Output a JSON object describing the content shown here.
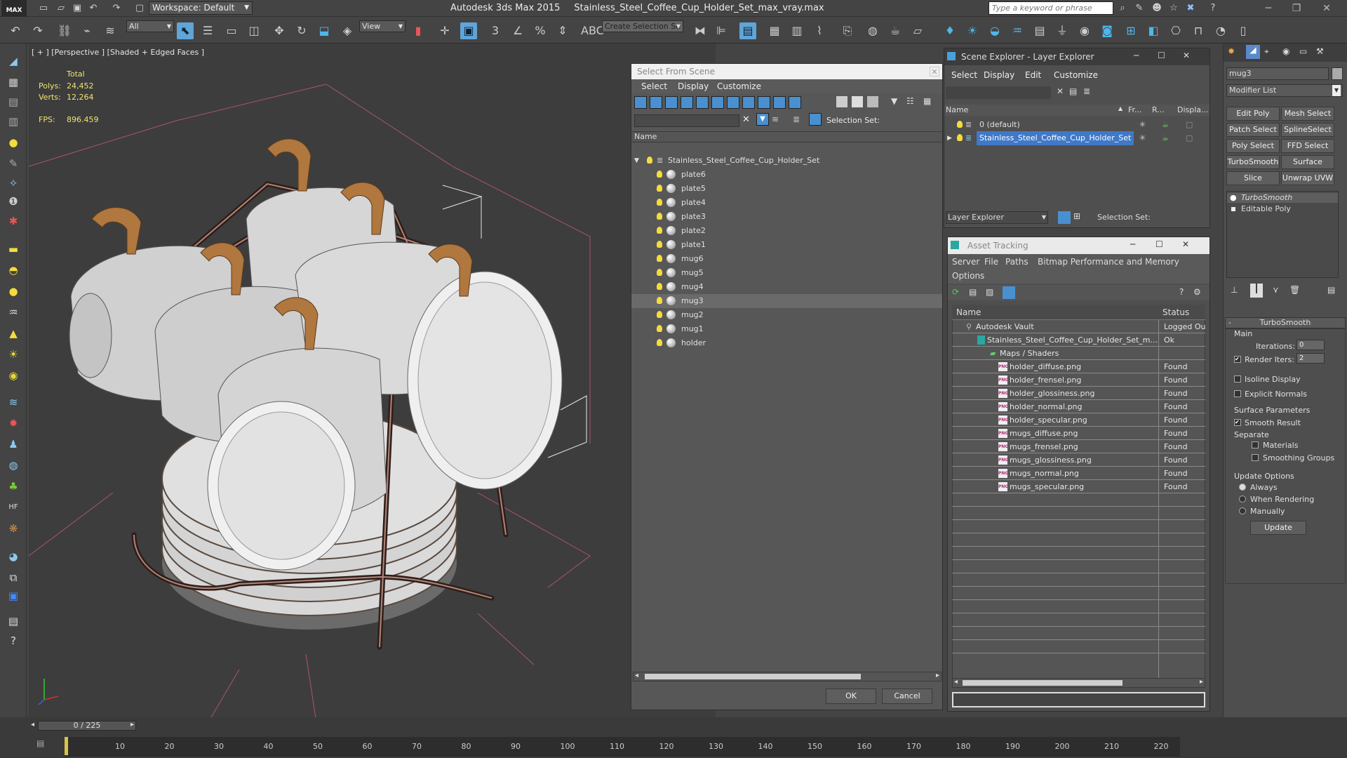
{
  "app": {
    "title": "Autodesk 3ds Max  2015",
    "file": "Stainless_Steel_Coffee_Cup_Holder_Set_max_vray.max",
    "logo": "MAX",
    "workspace": "Workspace: Default",
    "search_placeholder": "Type a keyword or phrase"
  },
  "toolbar": {
    "filter": "All",
    "ref_coord": "View",
    "selection_set": "Create Selection Se"
  },
  "viewport": {
    "label": "[ + ] [Perspective ] [Shaded + Edged Faces ]",
    "total_label": "Total",
    "polys_label": "Polys:",
    "polys": "24,452",
    "verts_label": "Verts:",
    "verts": "12,264",
    "fps_label": "FPS:",
    "fps": "896.459"
  },
  "select_from_scene": {
    "title": "Select From Scene",
    "menu": [
      "Select",
      "Display",
      "Customize"
    ],
    "selection_set_label": "Selection Set:",
    "column_name": "Name",
    "root": "Stainless_Steel_Coffee_Cup_Holder_Set",
    "items": [
      "plate6",
      "plate5",
      "plate4",
      "plate3",
      "plate2",
      "plate1",
      "mug6",
      "mug5",
      "mug4",
      "mug3",
      "mug2",
      "mug1",
      "holder"
    ],
    "selected": "mug3",
    "ok": "OK",
    "cancel": "Cancel"
  },
  "scene_explorer": {
    "title": "Scene Explorer - Layer Explorer",
    "menu": [
      "Select",
      "Display",
      "Edit",
      "Customize"
    ],
    "columns": [
      "Name",
      "Fr...",
      "R...",
      "Displa..."
    ],
    "layers": [
      "0 (default)",
      "Stainless_Steel_Coffee_Cup_Holder_Set"
    ],
    "footer_dropdown": "Layer Explorer",
    "selection_set_label": "Selection Set:"
  },
  "asset_tracking": {
    "title": "Asset Tracking",
    "menu": [
      "Server",
      "File",
      "Paths",
      "Bitmap Performance and Memory",
      "Options"
    ],
    "columns": [
      "Name",
      "Status"
    ],
    "rows": [
      {
        "name": "Autodesk Vault",
        "status": "Logged Ou"
      },
      {
        "name": "Stainless_Steel_Coffee_Cup_Holder_Set_m...",
        "status": "Ok"
      },
      {
        "name": "Maps / Shaders",
        "status": ""
      },
      {
        "name": "holder_diffuse.png",
        "status": "Found"
      },
      {
        "name": "holder_frensel.png",
        "status": "Found"
      },
      {
        "name": "holder_glossiness.png",
        "status": "Found"
      },
      {
        "name": "holder_normal.png",
        "status": "Found"
      },
      {
        "name": "holder_specular.png",
        "status": "Found"
      },
      {
        "name": "mugs_diffuse.png",
        "status": "Found"
      },
      {
        "name": "mugs_frensel.png",
        "status": "Found"
      },
      {
        "name": "mugs_glossiness.png",
        "status": "Found"
      },
      {
        "name": "mugs_normal.png",
        "status": "Found"
      },
      {
        "name": "mugs_specular.png",
        "status": "Found"
      }
    ]
  },
  "command_panel": {
    "object_name": "mug3",
    "modifier_list": "Modifier List",
    "buttons": [
      "Edit Poly",
      "Mesh Select",
      "Patch Select",
      "SplineSelect",
      "Poly Select",
      "FFD Select",
      "TurboSmooth",
      "Surface Select",
      "Slice",
      "Unwrap UVW"
    ],
    "stack": [
      "TurboSmooth",
      "Editable Poly"
    ],
    "rollout_title": "TurboSmooth",
    "main_label": "Main",
    "iterations_label": "Iterations:",
    "iterations": "0",
    "render_iters_label": "Render Iters:",
    "render_iters": "2",
    "isoline": "Isoline Display",
    "explicit_normals": "Explicit Normals",
    "surface_params": "Surface Parameters",
    "smooth_result": "Smooth Result",
    "separate": "Separate",
    "materials": "Materials",
    "smoothing_groups": "Smoothing Groups",
    "update_options": "Update Options",
    "always": "Always",
    "when_rendering": "When Rendering",
    "manually": "Manually",
    "update_btn": "Update"
  },
  "timeline": {
    "frame": "0 / 225",
    "ticks": [
      "10",
      "20",
      "30",
      "40",
      "50",
      "60",
      "70",
      "80",
      "90",
      "100",
      "110",
      "120",
      "130",
      "140",
      "150",
      "160",
      "170",
      "180",
      "190",
      "200",
      "210",
      "220"
    ]
  }
}
